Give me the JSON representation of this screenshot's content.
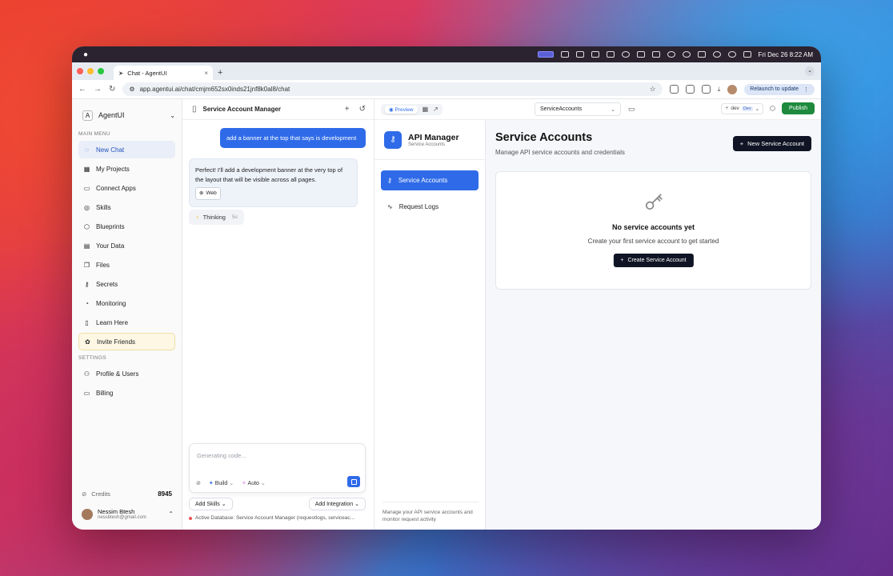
{
  "menubar": {
    "apple": "",
    "datetime": "Fri Dec 26  8:22 AM"
  },
  "browser": {
    "tab_title": "Chat - AgentUI",
    "tab_close": "×",
    "new_tab": "+",
    "url": "app.agentui.ai/chat/cmjm652sx0inds21jnf8k0al8/chat",
    "relaunch": "Relaunch to update"
  },
  "sidebar": {
    "brand": "AgentUI",
    "brand_logo": "A",
    "main_menu_label": "MAIN MENU",
    "settings_label": "SETTINGS",
    "items": [
      {
        "label": "New Chat",
        "icon": "chat-icon"
      },
      {
        "label": "My Projects",
        "icon": "grid-icon"
      },
      {
        "label": "Connect Apps",
        "icon": "briefcase-icon"
      },
      {
        "label": "Skills",
        "icon": "compass-icon"
      },
      {
        "label": "Blueprints",
        "icon": "cube-icon"
      },
      {
        "label": "Your Data",
        "icon": "table-icon"
      },
      {
        "label": "Files",
        "icon": "files-icon"
      },
      {
        "label": "Secrets",
        "icon": "key-icon"
      },
      {
        "label": "Monitoring",
        "icon": "gauge-icon"
      },
      {
        "label": "Learn Here",
        "icon": "book-icon"
      },
      {
        "label": "Invite Friends",
        "icon": "gift-icon"
      }
    ],
    "settings_items": [
      {
        "label": "Profile & Users",
        "icon": "users-icon"
      },
      {
        "label": "Billing",
        "icon": "card-icon"
      }
    ],
    "credits_label": "Credits",
    "credits_value": "8945",
    "user_name": "Nessim Btesh",
    "user_email": "nessbtesh@gmail.com"
  },
  "chat": {
    "title": "Service Account Manager",
    "user_message": "add a banner at the top that says is development",
    "ai_message": "Perfect! I'll add a development banner at the very top of the layout that will be visible across all pages.",
    "web_badge": "Web",
    "thinking": "Thinking",
    "thinking_time": "5s",
    "composer_placeholder": "Generating code...",
    "build_label": "Build",
    "auto_label": "Auto",
    "add_skills": "Add Skills",
    "add_integration": "Add Integration",
    "db_line": "Active Database: Service Account Manager (requestlogs, serviceac..."
  },
  "preview": {
    "preview_label": "Preview",
    "route": "ServiceAccounts",
    "branch": "dev",
    "env_tag": "Dev",
    "publish": "Publish",
    "app": {
      "name": "API Manager",
      "subtitle": "Service Accounts",
      "nav": [
        {
          "label": "Service Accounts",
          "active": true
        },
        {
          "label": "Request Logs",
          "active": false
        }
      ],
      "footer": "Manage your API service accounts and monitor request activity",
      "page_title": "Service Accounts",
      "page_subtitle": "Manage API service accounts and credentials",
      "new_button": "New Service Account",
      "empty_title": "No service accounts yet",
      "empty_text": "Create your first service account to get started",
      "create_button": "Create Service Account"
    }
  },
  "colors": {
    "accent": "#2f6be8",
    "publish": "#1e8a3e",
    "dark_button": "#0f1524"
  }
}
